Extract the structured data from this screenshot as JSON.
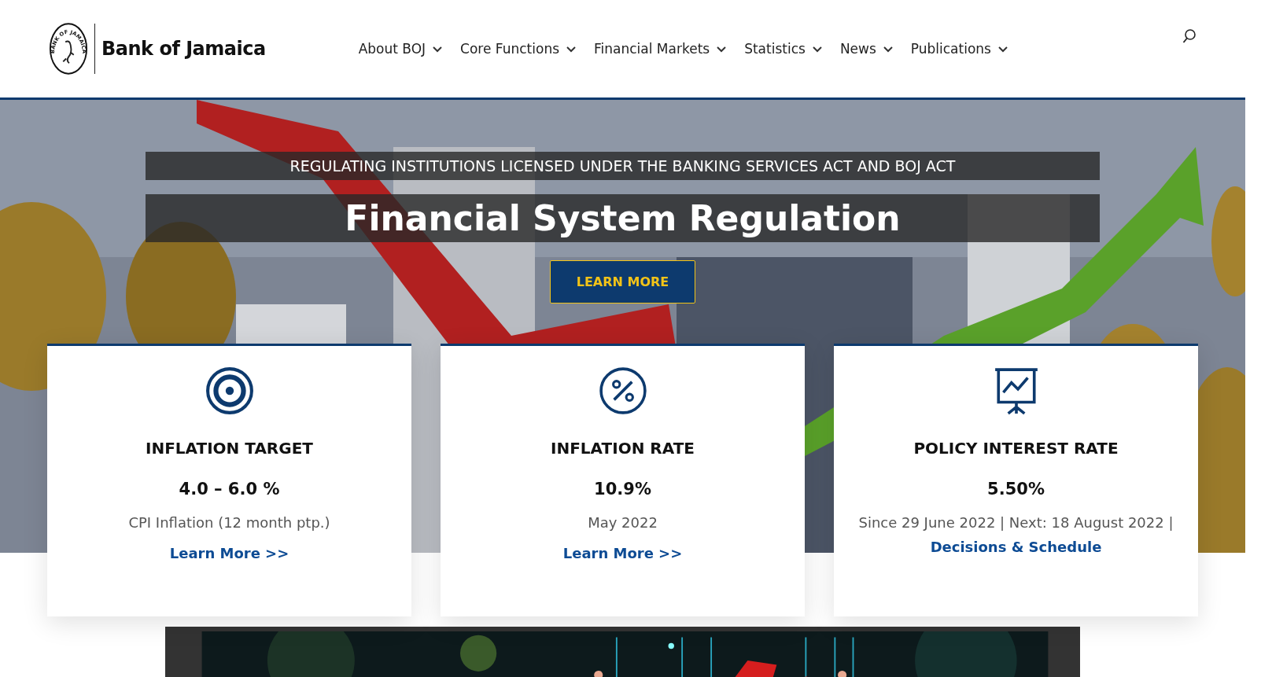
{
  "header": {
    "logo_text": "Bank of Jamaica",
    "seal_text": "BANK OF JAMAICA"
  },
  "nav": [
    {
      "label": "About BOJ"
    },
    {
      "label": "Core Functions"
    },
    {
      "label": "Financial Markets"
    },
    {
      "label": "Statistics"
    },
    {
      "label": "News"
    },
    {
      "label": "Publications"
    }
  ],
  "hero": {
    "kicker": "REGULATING INSTITUTIONS LICENSED UNDER THE BANKING SERVICES ACT AND BOJ ACT",
    "title": "Financial System Regulation",
    "button": "LEARN MORE"
  },
  "cards": [
    {
      "kind": "target",
      "title": "INFLATION TARGET",
      "value": "4.0 – 6.0 %",
      "note": "CPI Inflation (12 month ptp.)",
      "link": "Learn More >>"
    },
    {
      "kind": "percent",
      "title": "INFLATION RATE",
      "value": "10.9%",
      "note": "May 2022",
      "link": "Learn More >>"
    },
    {
      "kind": "chart",
      "title": "POLICY INTEREST RATE",
      "value": "5.50%",
      "note": "Since 29 June 2022 | Next: 18 August 2022 |",
      "link": "Decisions & Schedule"
    }
  ]
}
